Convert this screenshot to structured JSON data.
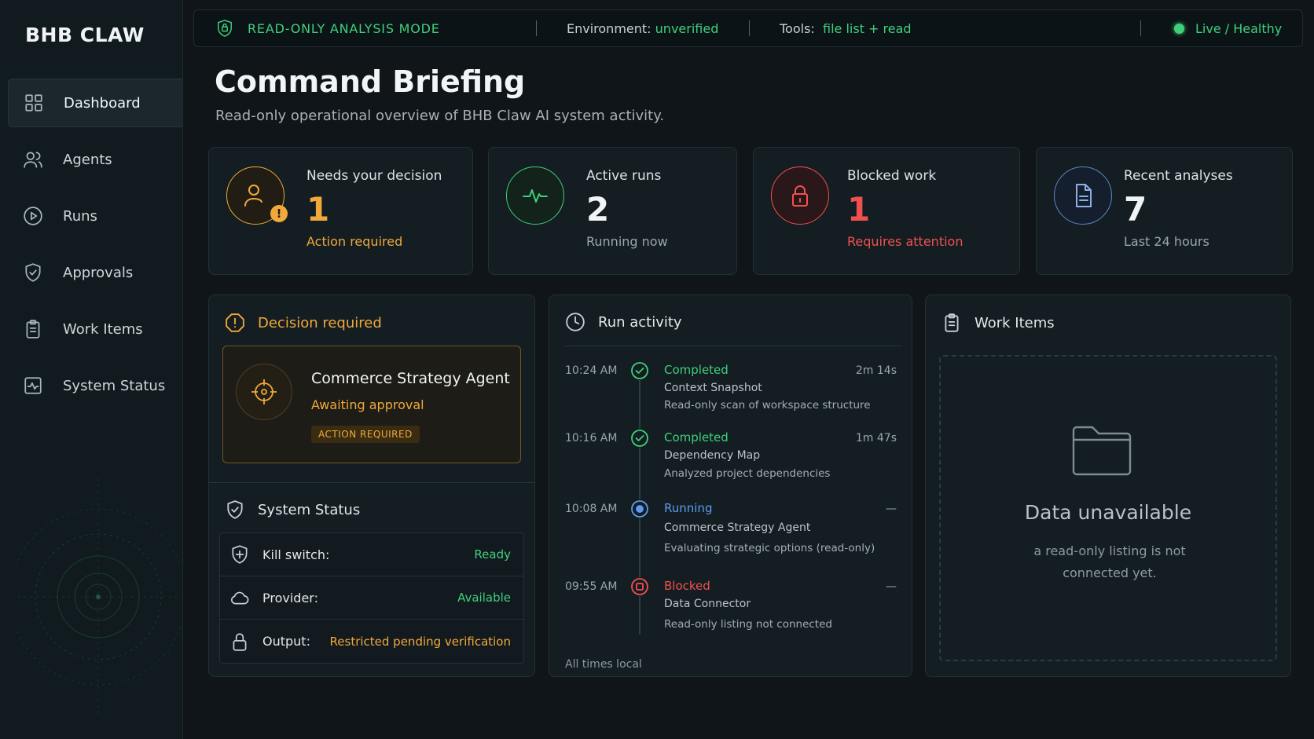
{
  "brand": "BHB CLAW",
  "sidebar": {
    "items": [
      {
        "label": "Dashboard",
        "icon": "dashboard-grid-icon",
        "active": true
      },
      {
        "label": "Agents",
        "icon": "users-icon"
      },
      {
        "label": "Runs",
        "icon": "play-circle-icon"
      },
      {
        "label": "Approvals",
        "icon": "shield-check-icon"
      },
      {
        "label": "Work Items",
        "icon": "clipboard-icon"
      },
      {
        "label": "System Status",
        "icon": "pulse-monitor-icon"
      }
    ]
  },
  "topbar": {
    "mode": "READ-ONLY ANALYSIS MODE",
    "env_label": "Environment:",
    "env_value": "unverified",
    "tools_label": "Tools:",
    "tools_value": "file list + read",
    "live": "Live / Healthy"
  },
  "header": {
    "title": "Command Briefing",
    "subtitle": "Read-only operational overview of BHB Claw AI system activity."
  },
  "stats": [
    {
      "label": "Needs your decision",
      "value": "1",
      "note": "Action required",
      "color": "#f0a93a"
    },
    {
      "label": "Active runs",
      "value": "2",
      "note": "Running now",
      "color": "#3fd07b"
    },
    {
      "label": "Blocked work",
      "value": "1",
      "note": "Requires attention",
      "color": "#f0514f"
    },
    {
      "label": "Recent analyses",
      "value": "7",
      "note": "Last 24 hours",
      "color": "#6f96d6"
    }
  ],
  "decision": {
    "title": "Decision required",
    "agent_name": "Commerce Strategy Agent",
    "agent_status": "Awaiting approval",
    "badge": "ACTION REQUIRED"
  },
  "system_status": {
    "title": "System Status",
    "rows": [
      {
        "key": "Kill switch:",
        "value": "Ready",
        "color": "#3fd07b"
      },
      {
        "key": "Provider:",
        "value": "Available",
        "color": "#3fd07b"
      },
      {
        "key": "Output:",
        "value": "Restricted pending verification",
        "color": "#f0a93a"
      }
    ]
  },
  "run_activity": {
    "title": "Run activity",
    "footer": "All times local",
    "items": [
      {
        "time": "10:24 AM",
        "state": "Completed",
        "duration": "2m 14s",
        "name": "Context Snapshot",
        "desc": "Read-only scan of workspace structure",
        "color": "#3fd07b"
      },
      {
        "time": "10:16 AM",
        "state": "Completed",
        "duration": "1m 47s",
        "name": "Dependency Map",
        "desc": "Analyzed project dependencies",
        "color": "#3fd07b"
      },
      {
        "time": "10:08 AM",
        "state": "Running",
        "duration": "—",
        "name": "Commerce Strategy Agent",
        "desc": "Evaluating strategic options (read-only)",
        "color": "#5b9bf0"
      },
      {
        "time": "09:55 AM",
        "state": "Blocked",
        "duration": "—",
        "name": "Data Connector",
        "desc": "Read-only listing not connected",
        "color": "#f0514f"
      }
    ]
  },
  "work_items": {
    "title": "Work Items",
    "empty_title": "Data unavailable",
    "empty_sub": "a read-only listing is not connected yet."
  }
}
